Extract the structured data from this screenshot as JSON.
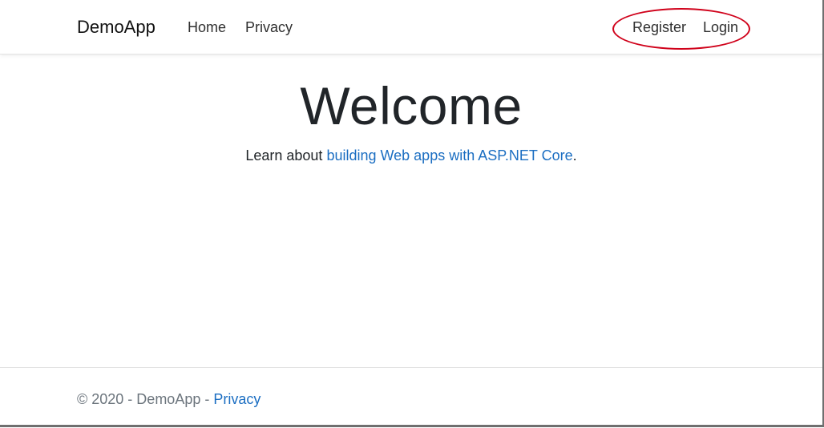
{
  "navbar": {
    "brand": "DemoApp",
    "links": {
      "home": "Home",
      "privacy": "Privacy"
    },
    "auth": {
      "register": "Register",
      "login": "Login"
    },
    "highlight_color": "#d0021b"
  },
  "hero": {
    "title": "Welcome",
    "text_before": "Learn about ",
    "link_text": "building Web apps with ASP.NET Core",
    "text_after": "."
  },
  "footer": {
    "copyright": "© 2020 - DemoApp - ",
    "privacy_link": "Privacy"
  },
  "colors": {
    "link": "#1b6ec2",
    "muted": "#6c757d",
    "text": "#212529"
  }
}
